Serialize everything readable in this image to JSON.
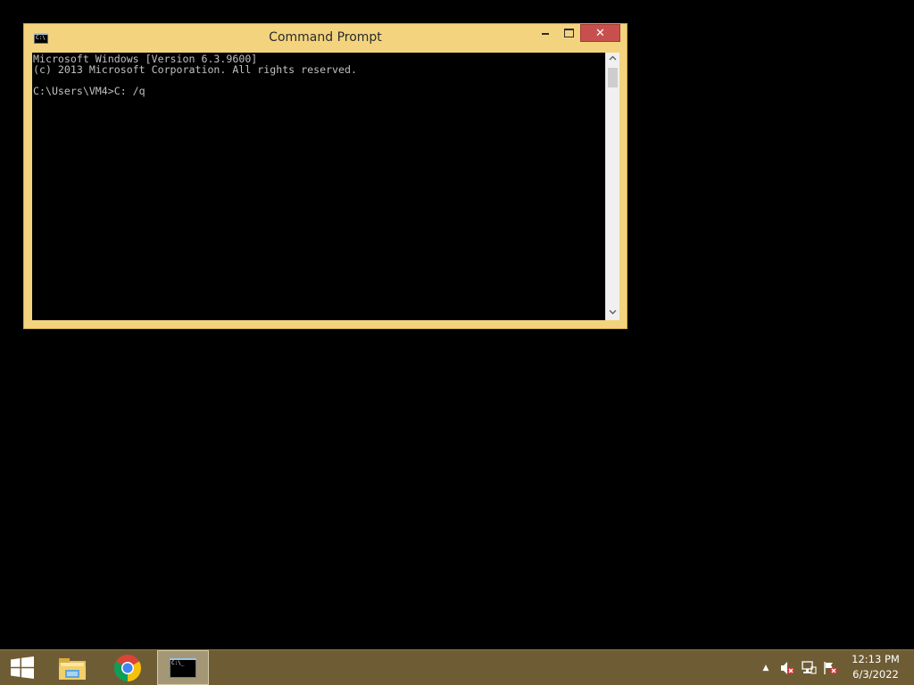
{
  "window": {
    "title": "Command Prompt",
    "icon": "cmd-icon",
    "icon_text": "C:\\",
    "minimize_label": "minimize",
    "maximize_label": "maximize",
    "close_glyph": "✕"
  },
  "console": {
    "lines": [
      "Microsoft Windows [Version 6.3.9600]",
      "(c) 2013 Microsoft Corporation. All rights reserved.",
      "C:\\Users\\VM4>C: /q"
    ],
    "background": "#000000",
    "foreground": "#c0c0c0"
  },
  "scrollbar": {
    "up_glyph": "︿",
    "down_glyph": "﹀"
  },
  "taskbar": {
    "color": "#6e5d34",
    "apps": [
      {
        "name": "File Explorer",
        "icon": "folder-icon"
      },
      {
        "name": "Google Chrome",
        "icon": "chrome-icon"
      },
      {
        "name": "Command Prompt",
        "icon": "cmd-icon",
        "active": true
      }
    ],
    "cmd_icon_text": "C:\\_",
    "tray": {
      "chevron": "▲",
      "icons": [
        "volume-muted-icon",
        "network-icon",
        "action-center-flag-icon"
      ]
    },
    "clock": {
      "time": "12:13 PM",
      "date": "6/3/2022"
    }
  },
  "colors": {
    "window_frame": "#f3d37e",
    "close_button": "#c7504e",
    "desktop": "#000000"
  }
}
